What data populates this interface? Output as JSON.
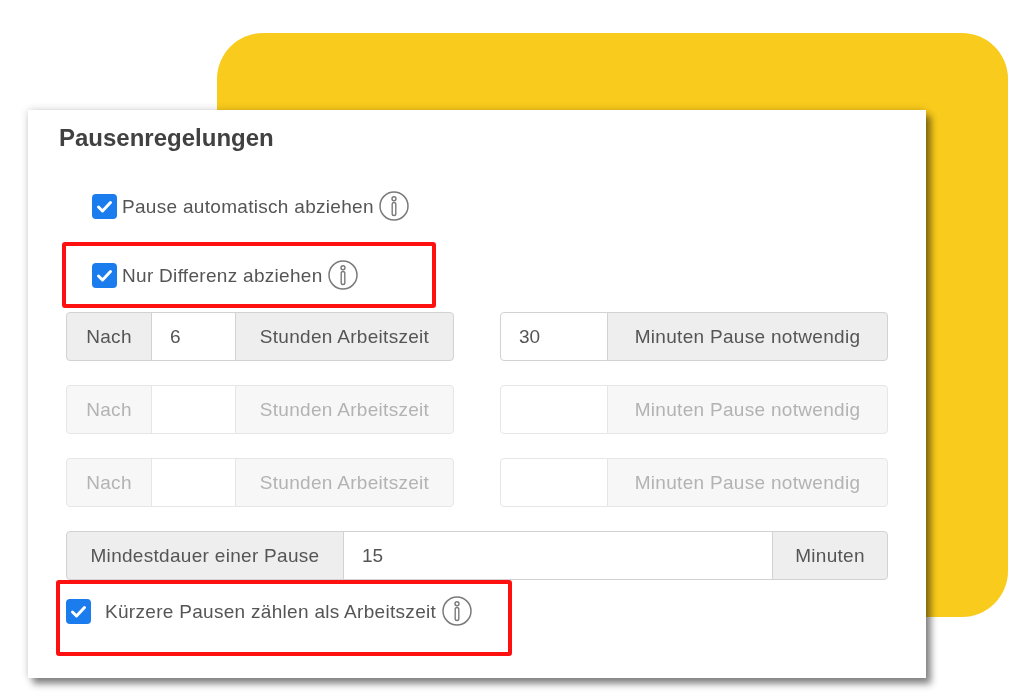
{
  "panel": {
    "title": "Pausenregelungen",
    "options": [
      {
        "label": "Pause automatisch abziehen",
        "checked": true,
        "highlighted": false
      },
      {
        "label": "Nur Differenz abziehen",
        "checked": true,
        "highlighted": true
      }
    ],
    "rules": [
      {
        "prefix": "Nach",
        "hours": "6",
        "hours_label": "Stunden Arbeitszeit",
        "minutes": "30",
        "minutes_label": "Minuten Pause notwendig",
        "disabled": false
      },
      {
        "prefix": "Nach",
        "hours_label": "Stunden Arbeitszeit",
        "minutes_label": "Minuten Pause notwendig",
        "disabled": true
      },
      {
        "prefix": "Nach",
        "hours_label": "Stunden Arbeitszeit",
        "minutes_label": "Minuten Pause notwendig",
        "disabled": true
      }
    ],
    "min_duration": {
      "label": "Mindestdauer einer Pause",
      "value": "15",
      "unit": "Minuten"
    },
    "short_breaks_option": {
      "label": "Kürzere Pausen zählen als Arbeitszeit",
      "checked": true,
      "highlighted": true
    }
  }
}
